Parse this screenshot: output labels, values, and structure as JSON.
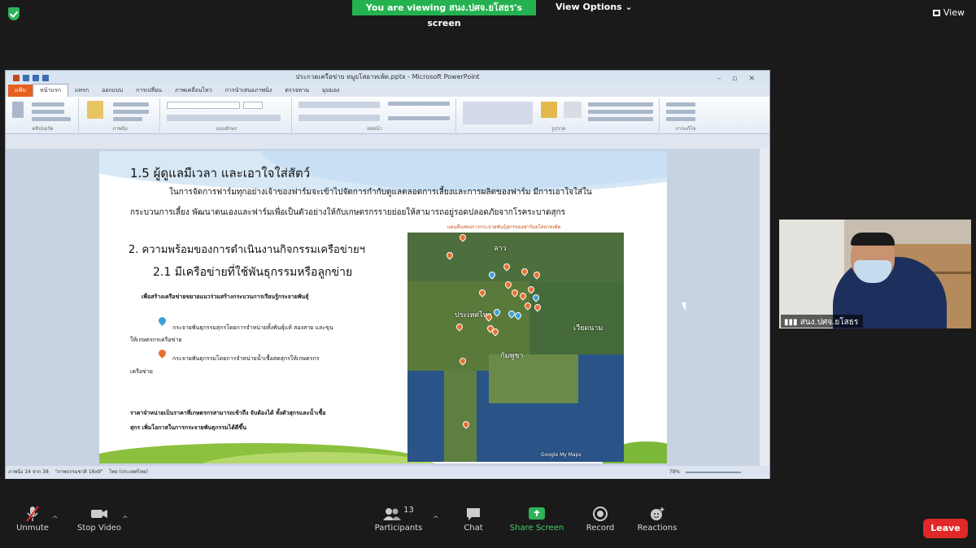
{
  "top": {
    "viewing_banner": "You are viewing สนง.ปศจ.ยโสธร's screen",
    "view_options": "View Options ⌄",
    "view_button": "View"
  },
  "ppt": {
    "window_title": "ประกวดเครือข่าย หมูยโสอาทเพ้ต.pptx - Microsoft PowerPoint",
    "tabs": [
      "แฟ้ม",
      "หน้าแรก",
      "แทรก",
      "ออกแบบ",
      "การเปลี่ยน",
      "ภาพเคลื่อนไหว",
      "การนำเสนอภาพนิ่ง",
      "ตรวจทาน",
      "มุมมอง"
    ],
    "ribbon_groups": [
      "คลิปบอร์ด",
      "ภาพนิ่ง",
      "แบบอักษร",
      "ย่อหน้า",
      "รูปวาด",
      "การแก้ไข"
    ],
    "slide": {
      "heading1": "1.5 ผู้ดูแลมีเวลา และเอาใจใส่สัตว์",
      "para_line1": "ในการจัดการฟาร์มทุกอย่างเจ้าของฟาร์มจะเข้าไปจัดการกำกับดูแลตลอดการเลี้ยงและการผลิตของฟาร์ม มีการเอาใจใส่ใน",
      "para_line2": "กระบวนการเลี้ยง พัฒนาตนเองและฟาร์มเพื่อเป็นตัวอย่างให้กับเกษตรกรรายย่อยให้สามารถอยู่รอดปลอดภัยจากโรคระบาดสุกร",
      "heading2": "2. ความพร้อมของการดำเนินงานกิจกรรมเครือข่ายฯ",
      "heading3": "2.1 มีเครือข่ายที่ใช้พันธุกรรมหรือลูกข่าย",
      "subhead": "เพื่อสร้างเครือข่ายขยายแนวร่วมสร้างกระบวนการเรียนรู้กระจายพันธุ์",
      "legend1_line1": "กระจายพันธุกรรมสุกรโดยการจำหน่ายทั้งพันธุ์แท้ สองสาย และขุน",
      "legend1_line2": "ให้เกษตรกรเครือข่าย",
      "legend2_line1": "กระจายพันธุกรรมโดยการจำหน่ายน้ำเชื้อสดสุกรให้เกษตรกร",
      "legend2_line2": "เครือข่าย",
      "footer_line1": "ราคาจำหน่ายเป็นราคาที่เกษตรกรสามารถเข้าถึง จับต้องได้ ทั้งตัวสุกรและน้ำเชื้อ",
      "footer_line2": "สุกร เพิ่มโอกาสในการกระจายพันธุกรรมได้ดีขึ้น",
      "map_title": "แผนที่แสดงการกระจายพันธุ์สุกรของฟาร์มยโสอาทเพ้ต",
      "map_labels": {
        "laos": "ลาว",
        "thailand": "ประเทศไทย",
        "cambodia": "กัมพูชา",
        "vietnam": "เวียดนาม",
        "google": "Google My Maps"
      }
    },
    "status": {
      "slide_info": "ภาพนิ่ง 14 จาก 38",
      "theme": "\"ภาพธรรมชาติ 16x9\"",
      "language": "ไทย (ประเทศไทย)",
      "zoom": "79%"
    }
  },
  "camera": {
    "name": "สนง.ปศจ.ยโสธร"
  },
  "toolbar": {
    "unmute": "Unmute",
    "stop_video": "Stop Video",
    "participants": "Participants",
    "participant_count": "13",
    "chat": "Chat",
    "share_screen": "Share Screen",
    "record": "Record",
    "reactions": "Reactions",
    "leave": "Leave"
  },
  "colors": {
    "zoom_green": "#23b24f",
    "leave_red": "#e02828",
    "ppt_file_tab": "#e6601f"
  }
}
